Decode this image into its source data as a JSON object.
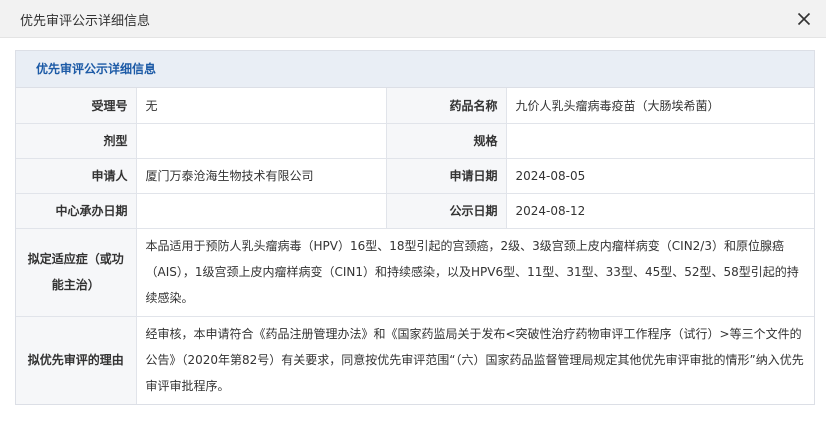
{
  "dialog": {
    "title": "优先审评公示详细信息",
    "close_icon": "close-icon"
  },
  "panel": {
    "heading": "优先审评公示详细信息"
  },
  "fields": {
    "acceptance_no_label": "受理号",
    "acceptance_no_value": "无",
    "drug_name_label": "药品名称",
    "drug_name_value": "九价人乳头瘤病毒疫苗（大肠埃希菌）",
    "dosage_form_label": "剂型",
    "dosage_form_value": "",
    "spec_label": "规格",
    "spec_value": "",
    "applicant_label": "申请人",
    "applicant_value": "厦门万泰沧海生物技术有限公司",
    "apply_date_label": "申请日期",
    "apply_date_value": "2024-08-05",
    "center_date_label": "中心承办日期",
    "center_date_value": "",
    "publicity_date_label": "公示日期",
    "publicity_date_value": "2024-08-12",
    "indication_label": "拟定适应症（或功能主治）",
    "indication_value": "本品适用于预防人乳头瘤病毒（HPV）16型、18型引起的宫颈癌，2级、3级宫颈上皮内瘤样病变（CIN2/3）和原位腺癌（AIS），1级宫颈上皮内瘤样病变（CIN1）和持续感染，以及HPV6型、11型、31型、33型、45型、52型、58型引起的持续感染。",
    "reason_label": "拟优先审评的理由",
    "reason_value": "经审核，本申请符合《药品注册管理办法》和《国家药监局关于发布<突破性治疗药物审评工作程序（试行）>等三个文件的公告》（2020年第82号）有关要求，同意按优先审评范围“（六）国家药品监督管理局规定其他优先审评审批的情形”纳入优先审评审批程序。"
  },
  "colors": {
    "heading_text": "#1c5aa6",
    "heading_bg": "#e9eef5",
    "label_bg": "#f6f7f9",
    "border": "#e1e4ea",
    "titlebar_bg": "#f2f2f2"
  }
}
